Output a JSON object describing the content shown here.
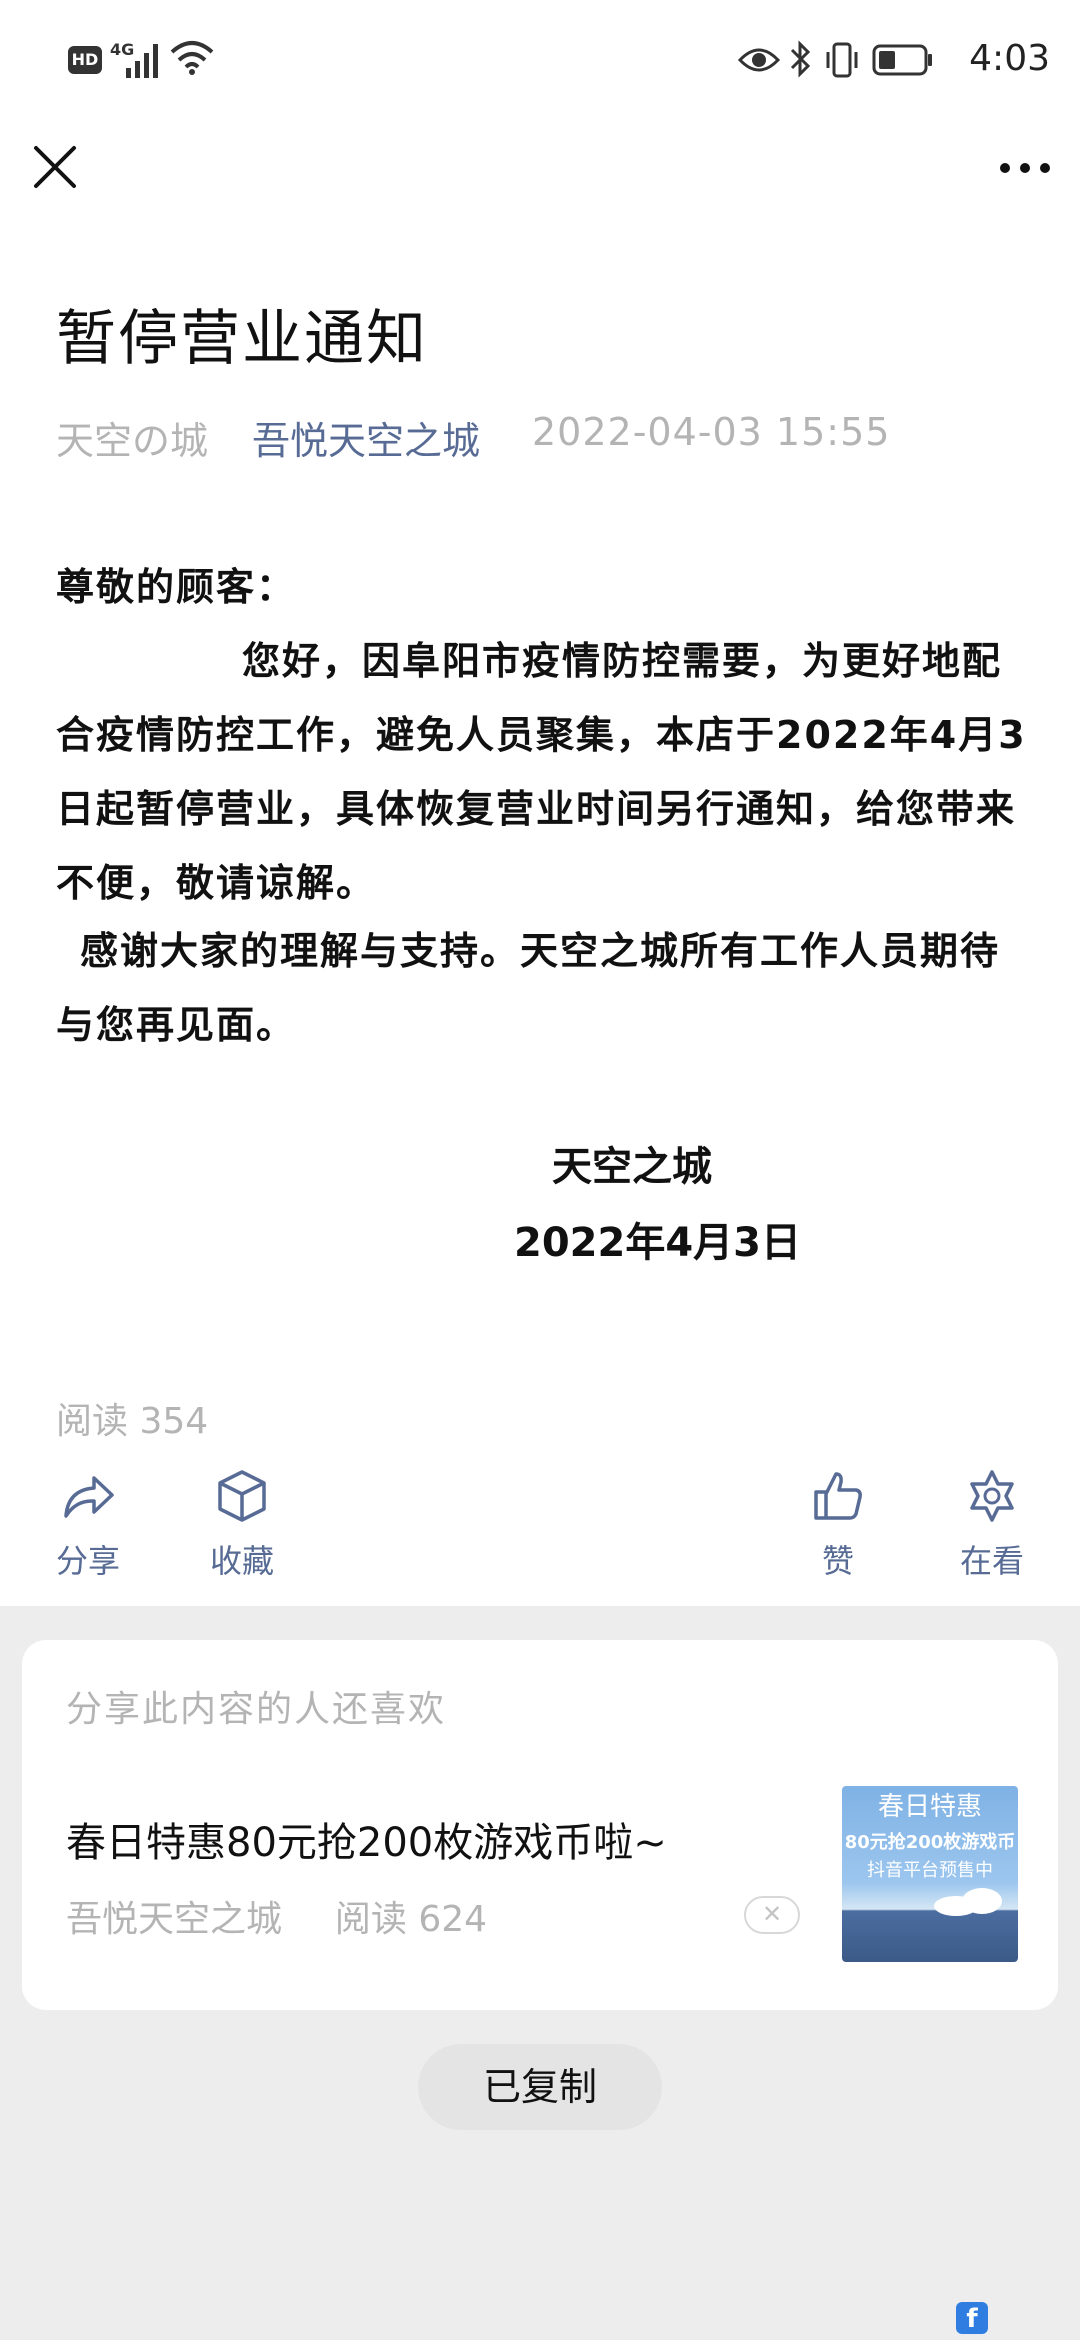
{
  "status_bar": {
    "hd": "HD",
    "network": "4G",
    "time": "4:03"
  },
  "nav": {
    "close_icon": "close-icon",
    "more_icon": "more-icon"
  },
  "article": {
    "title": "暂停营业通知",
    "source": "天空の城",
    "account": "吾悦天空之城",
    "date": "2022-04-03 15:55",
    "greeting": "尊敬的顾客：",
    "paragraph1": "您好，因阜阳市疫情防控需要，为更好地配合疫情防控工作，避免人员聚集，本店于2022年4月3日起暂停营业，具体恢复营业时间另行通知，给您带来不便，敬请谅解。",
    "paragraph2": "感谢大家的理解与支持。天空之城所有工作人员期待与您再见面。",
    "signature": "天空之城",
    "signature_date": "2022年4月3日",
    "read_count": "阅读 354"
  },
  "actions": {
    "share": "分享",
    "collect": "收藏",
    "like": "赞",
    "watching": "在看"
  },
  "recommend": {
    "heading": "分享此内容的人还喜欢",
    "item_title": "春日特惠80元抢200枚游戏币啦~",
    "item_account": "吾悦天空之城",
    "item_read": "阅读 624",
    "thumb_title": "春日特惠",
    "thumb_line1": "80元抢200枚游戏币",
    "thumb_line2": "抖音平台预售中"
  },
  "toast": "已复制",
  "colors": {
    "link": "#576b95",
    "meta_grey": "#b4b4b4",
    "page_grey": "#ededed"
  }
}
